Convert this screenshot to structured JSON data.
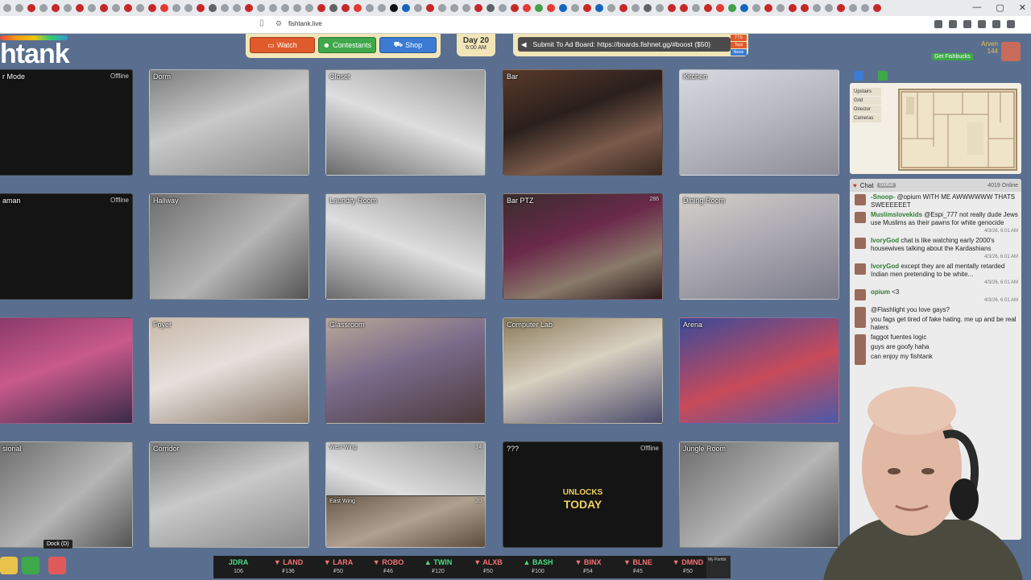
{
  "browser": {
    "url": "fishtank.live",
    "tab_icon_colors": [
      "#9aa0a6",
      "#9aa0a6",
      "#c62828",
      "#9aa0a6",
      "#c62828",
      "#9aa0a6",
      "#c62828",
      "#9aa0a6",
      "#c62828",
      "#9aa0a6",
      "#c62828",
      "#9aa0a6",
      "#c62828",
      "#e53935",
      "#9aa0a6",
      "#9aa0a6",
      "#c62828",
      "#5f6368",
      "#9aa0a6",
      "#9aa0a6",
      "#c62828",
      "#9aa0a6",
      "#9aa0a6",
      "#9aa0a6",
      "#9aa0a6",
      "#9aa0a6",
      "#c62828",
      "#5f6368",
      "#c62828",
      "#e53935",
      "#9aa0a6",
      "#9aa0a6",
      "#111111",
      "#1565c0",
      "#9aa0a6",
      "#c62828",
      "#9aa0a6",
      "#9aa0a6",
      "#9aa0a6",
      "#c62828",
      "#5f6368",
      "#9aa0a6",
      "#c62828",
      "#e53935",
      "#43a047",
      "#e53935",
      "#1565c0",
      "#9aa0a6",
      "#c62828",
      "#1565c0",
      "#9aa0a6",
      "#c62828",
      "#9aa0a6",
      "#5f6368",
      "#9aa0a6",
      "#c62828",
      "#c62828",
      "#9aa0a6",
      "#c62828",
      "#e53935",
      "#43a047",
      "#1565c0",
      "#9aa0a6",
      "#c62828",
      "#9aa0a6",
      "#c62828",
      "#c62828",
      "#9aa0a6",
      "#9aa0a6",
      "#c62828",
      "#9aa0a6",
      "#9aa0a6",
      "#c62828"
    ]
  },
  "header": {
    "logo": "htank",
    "nav": [
      {
        "label": "Watch",
        "icon": "tv-icon"
      },
      {
        "label": "Contestants",
        "icon": "people-icon"
      },
      {
        "label": "Shop",
        "icon": "cart-icon"
      }
    ],
    "day_label": "Day 20",
    "time_label": "6:00 AM",
    "ad_board_text": "Submit To Ad Board: https://boards.fishnet.gg/#boost ($50)",
    "ad_tags": [
      "TTS",
      "Toys",
      "News"
    ],
    "get_fishbucks": "Get Fishbucks",
    "username": "Arven",
    "balance": "144"
  },
  "cameras": [
    {
      "name": "r Mode",
      "status": "Offline"
    },
    {
      "name": "Dorm",
      "status": ""
    },
    {
      "name": "Closet",
      "status": ""
    },
    {
      "name": "Bar",
      "status": ""
    },
    {
      "name": "Kitchen",
      "status": ""
    },
    {
      "name": "aman",
      "status": "Offline"
    },
    {
      "name": "Hallway",
      "status": ""
    },
    {
      "name": "Laundry Room",
      "status": ""
    },
    {
      "name": "Bar PTZ",
      "status": "286"
    },
    {
      "name": "Dining Room",
      "status": ""
    },
    {
      "name": "",
      "status": ""
    },
    {
      "name": "Foyer",
      "status": ""
    },
    {
      "name": "Glassroom",
      "status": ""
    },
    {
      "name": "Computer Lab",
      "status": ""
    },
    {
      "name": "Arena",
      "status": ""
    },
    {
      "name": "sional",
      "status": ""
    },
    {
      "name": "Corridor",
      "status": ""
    },
    {
      "name": "West Wing",
      "status": "14",
      "sub_name": "East Wing",
      "sub_status": "20"
    },
    {
      "name": "???",
      "status": "Offline",
      "unlock_line1": "UNLOCKS",
      "unlock_line2": "TODAY"
    },
    {
      "name": "Jungle Room",
      "status": ""
    }
  ],
  "map": {
    "tabs": [
      "Upstairs",
      "Grid",
      "Director",
      "Cameras"
    ]
  },
  "chat": {
    "title": "Chat",
    "scope": "Global",
    "online": "4019 Online",
    "messages": [
      {
        "user": "-Snoop-",
        "text": "@opium WITH ME AWWWWWW THATS SWEEEEEET",
        "time": ""
      },
      {
        "user": "Muslimslovekids",
        "text": "@Espi_777 not really dude Jews use Muslims as their pawns for white genocide",
        "time": "4/3/26, 6:01 AM"
      },
      {
        "user": "IvoryGod",
        "text": "chat is like watching early 2000's housewives talking about the Kardashians",
        "time": "4/3/26, 6:01 AM"
      },
      {
        "user": "IvoryGod",
        "text": "except they are all mentally retarded Indian men pretending to be white...",
        "time": "4/3/26, 6:01 AM"
      },
      {
        "user": "opium",
        "text": "<3",
        "time": "4/3/26, 6:01 AM"
      },
      {
        "user": "",
        "text": "@Flashlight you love gays?",
        "time": ""
      },
      {
        "user": "",
        "text": "you fags get tired of fake hating. me up and be real haters",
        "time": ""
      },
      {
        "user": "",
        "text": "faggot fuentes logic",
        "time": ""
      },
      {
        "user": "",
        "text": "guys are goofy haha",
        "time": ""
      },
      {
        "user": "",
        "text": "can enjoy my fishtank",
        "time": ""
      }
    ]
  },
  "ticker": [
    {
      "sym": "JDRA",
      "price": "106",
      "dir": "flat"
    },
    {
      "sym": "LAND",
      "price": "₣136",
      "dir": "down"
    },
    {
      "sym": "LARA",
      "price": "₣50",
      "dir": "down"
    },
    {
      "sym": "ROBO",
      "price": "₣46",
      "dir": "down"
    },
    {
      "sym": "TWIN",
      "price": "₣120",
      "dir": "up"
    },
    {
      "sym": "ALXB",
      "price": "₣50",
      "dir": "down"
    },
    {
      "sym": "BASH",
      "price": "₣100",
      "dir": "up"
    },
    {
      "sym": "BINX",
      "price": "₣54",
      "dir": "down"
    },
    {
      "sym": "BLNE",
      "price": "₣45",
      "dir": "down"
    },
    {
      "sym": "DMND",
      "price": "₣50",
      "dir": "down"
    }
  ],
  "portfolio_label": "My Portfol",
  "dock_tooltip": "Dock (D)"
}
